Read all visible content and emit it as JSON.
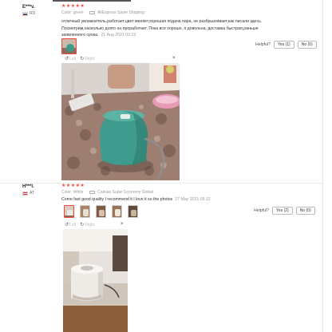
{
  "reviews": [
    {
      "user": "E***v.",
      "country": "RU",
      "stars": "★★★★★",
      "color_label": "Color:",
      "color_value": "green",
      "shipping": "AliExpress Saver Shipping",
      "text": "отличный увлажнитель,работает,цвет меняет,хорошая подача пара, не разбрызгивает,как писали здесь. Посмотрим,насколько долго он проработает. Пока все хорошо, я довольна, доставка быстрая,раньше заявленного срока.",
      "date": "21 Aug 2021 03:19",
      "helpful": "Helpful?",
      "yes": "Yes (1)",
      "no": "No (0)",
      "viewer": {
        "left": "Left",
        "right": "Right",
        "close": "×"
      }
    },
    {
      "user": "H***l.",
      "country": "AT",
      "stars": "★★★★★",
      "color_label": "Color:",
      "color_value": "White",
      "shipping": "Cainiao Super Economy Global",
      "text": "Come fast good quality I recommend it I love it so the photos",
      "date": "27 May 2021 05:12",
      "helpful": "Helpful?",
      "yes": "Yes (2)",
      "no": "No (0)",
      "viewer": {
        "left": "Left",
        "right": "Right",
        "close": "×"
      }
    }
  ],
  "colors": {
    "stars": "#f2473f",
    "muted": "#999999"
  }
}
